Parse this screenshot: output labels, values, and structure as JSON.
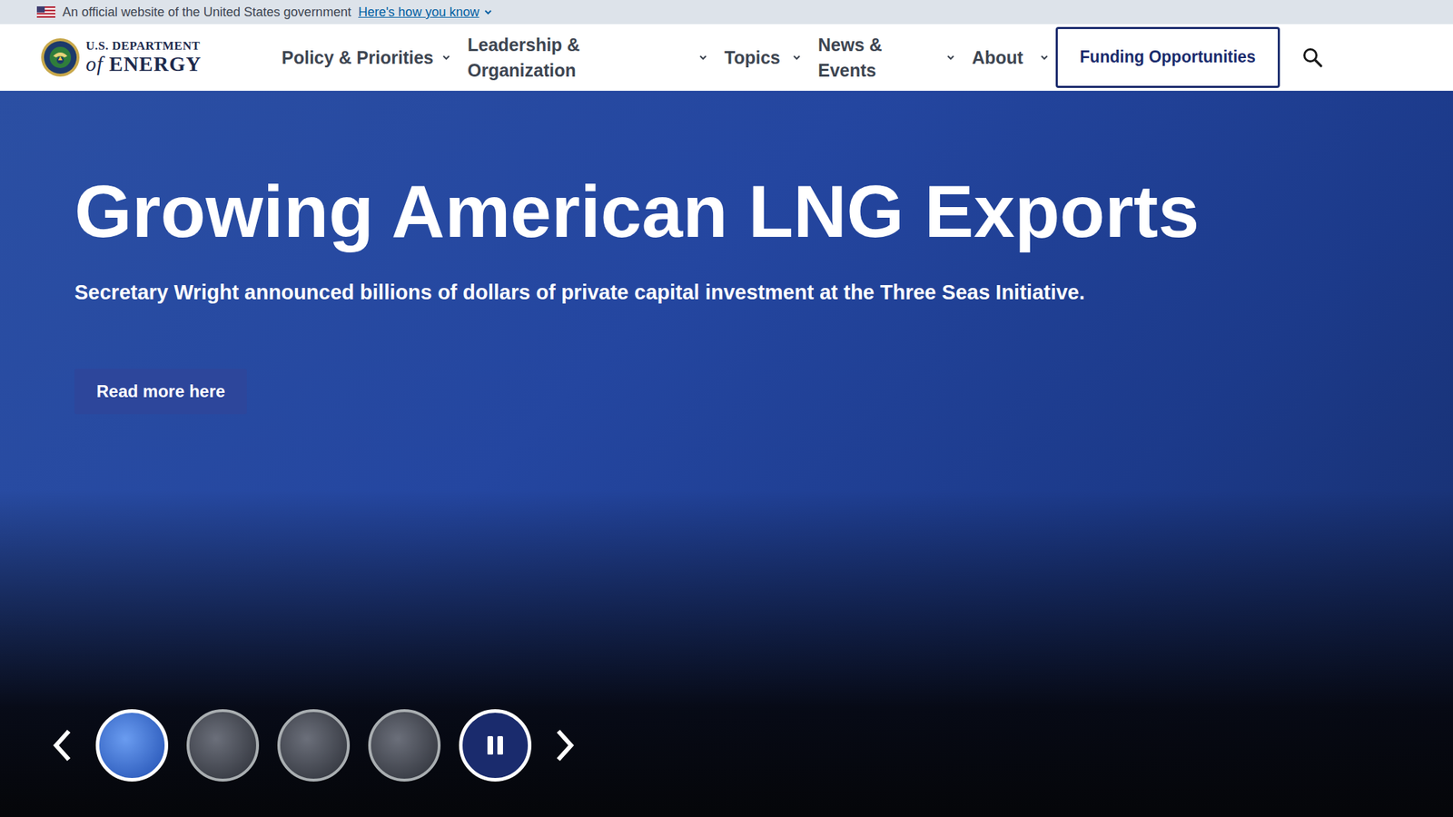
{
  "banner": {
    "text": "An official website of the United States government",
    "link": "Here's how you know",
    "expanded": false
  },
  "logo": {
    "line1": "U.S. DEPARTMENT",
    "of": "of",
    "line2": "ENERGY"
  },
  "nav": [
    {
      "label": "Policy & Priorities",
      "expanded": false
    },
    {
      "label": "Leadership & Organization",
      "expanded": false
    },
    {
      "label": "Topics",
      "expanded": false
    },
    {
      "label": "News & Events",
      "expanded": false
    },
    {
      "label": "About",
      "expanded": false
    }
  ],
  "cta": "Funding Opportunities",
  "hero": {
    "title": "Growing American LNG Exports",
    "subtitle": "Secretary Wright announced billions of dollars of private capital investment at the Three Seas Initiative.",
    "button": "Read more here"
  },
  "carousel": {
    "slides": [
      {
        "selected": true
      },
      {
        "selected": false
      },
      {
        "selected": false
      },
      {
        "selected": false
      }
    ],
    "playing": true
  }
}
